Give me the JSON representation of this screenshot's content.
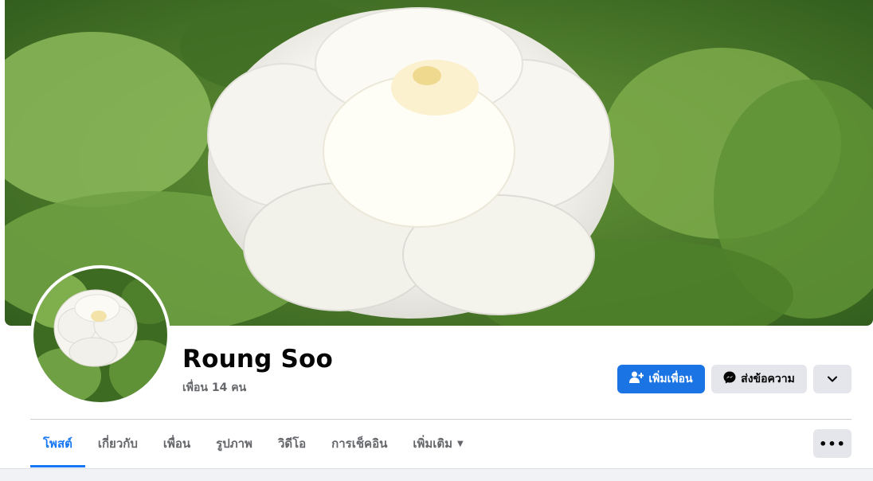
{
  "profile": {
    "name": "Roung Soo",
    "friends_label": "เพื่อน 14 คน"
  },
  "actions": {
    "add_friend_label": "เพิ่มเพื่อน",
    "message_label": "ส่งข้อความ"
  },
  "tabs": [
    {
      "label": "โพสต์",
      "active": true
    },
    {
      "label": "เกี่ยวกับ",
      "active": false
    },
    {
      "label": "เพื่อน",
      "active": false
    },
    {
      "label": "รูปภาพ",
      "active": false
    },
    {
      "label": "วิดีโอ",
      "active": false
    },
    {
      "label": "การเช็คอิน",
      "active": false
    },
    {
      "label": "เพิ่มเติม",
      "active": false
    }
  ],
  "icons": {
    "add_friend": "person-plus-icon",
    "message": "messenger-icon",
    "dropdown": "chevron-down-icon",
    "more": "ellipsis-icon"
  },
  "colors": {
    "accent": "#1877f2",
    "primary_button": "#1b74e4",
    "secondary_button": "#e4e6eb"
  }
}
